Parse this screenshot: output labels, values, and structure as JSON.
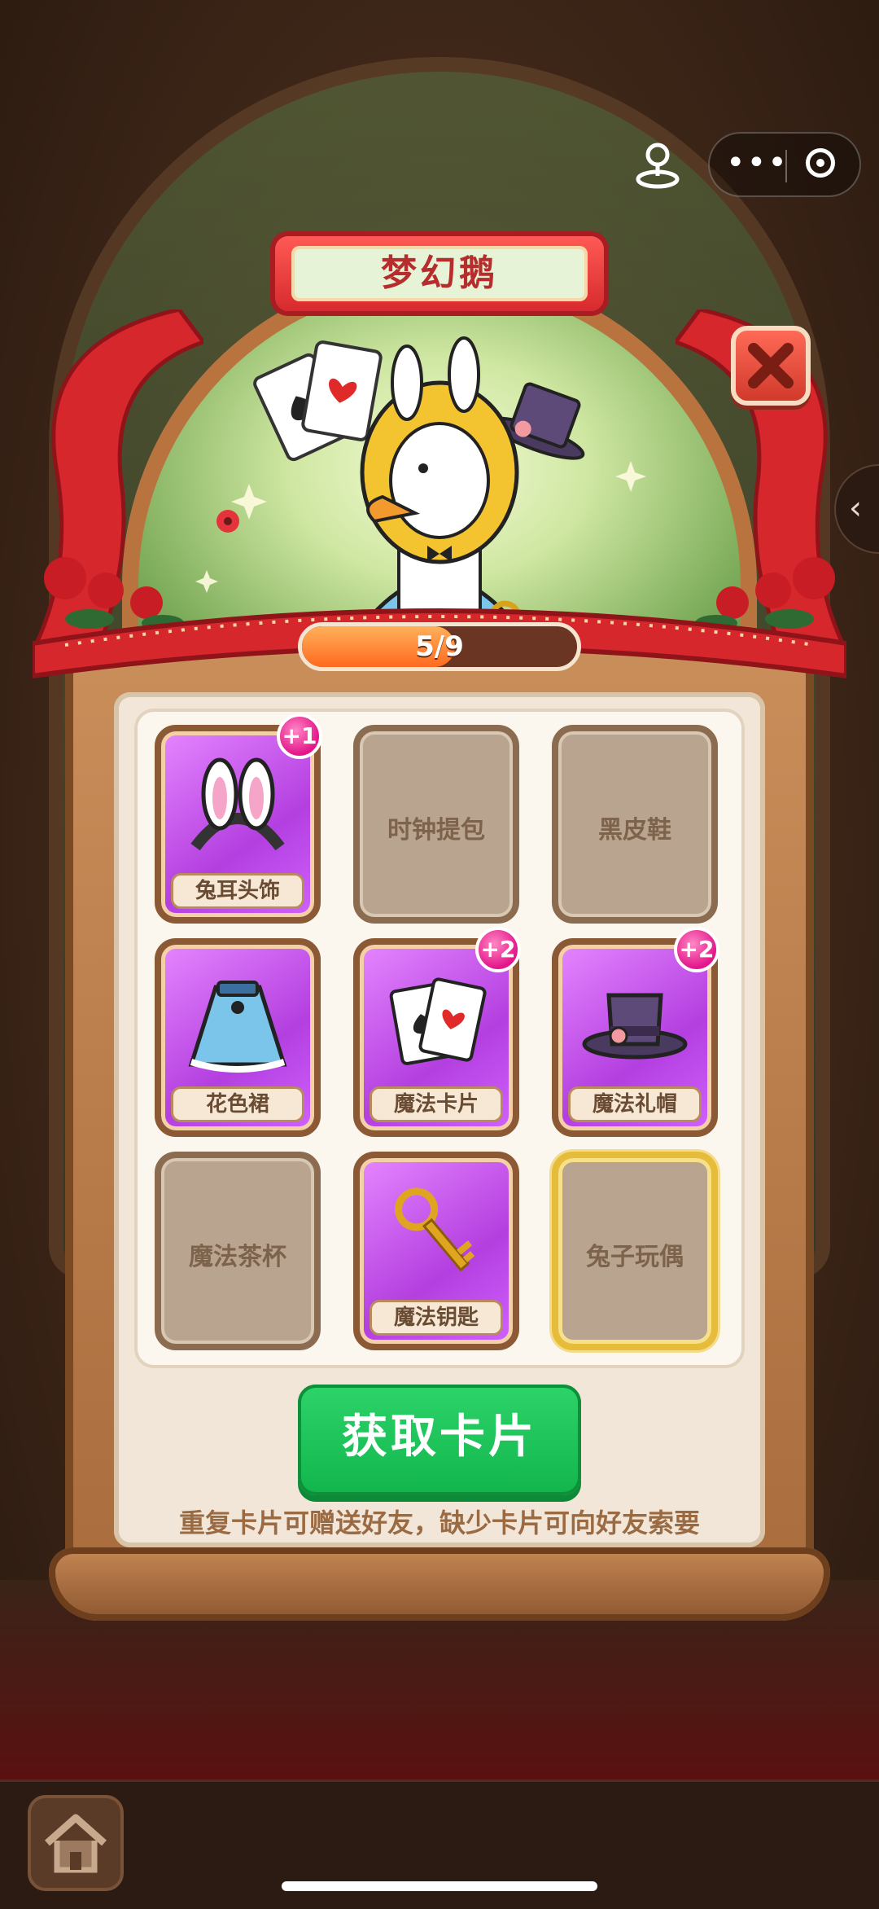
{
  "header": {
    "title": "梦幻鹅",
    "progress_text": "5/9",
    "progress_fraction": 0.556
  },
  "cards": [
    {
      "name": "兔耳头饰",
      "owned": true,
      "badge": "+1",
      "icon": "bunny-ears-headband-icon"
    },
    {
      "name": "时钟提包",
      "owned": false,
      "badge": "",
      "icon": ""
    },
    {
      "name": "黑皮鞋",
      "owned": false,
      "badge": "",
      "icon": ""
    },
    {
      "name": "花色裙",
      "owned": true,
      "badge": "",
      "icon": "floral-skirt-icon"
    },
    {
      "name": "魔法卡片",
      "owned": true,
      "badge": "+2",
      "icon": "playing-cards-icon"
    },
    {
      "name": "魔法礼帽",
      "owned": true,
      "badge": "+2",
      "icon": "top-hat-icon"
    },
    {
      "name": "魔法茶杯",
      "owned": false,
      "badge": "",
      "icon": ""
    },
    {
      "name": "魔法钥匙",
      "owned": true,
      "badge": "",
      "icon": "golden-key-icon"
    },
    {
      "name": "兔子玩偶",
      "owned": false,
      "badge": "",
      "icon": "",
      "highlighted": true
    }
  ],
  "actions": {
    "get_cards_label": "获取卡片",
    "hint": "重复卡片可赠送好友，缺少卡片可向好友索要"
  },
  "colors": {
    "accent_green": "#1ec45a",
    "card_purple": "#c04fe8",
    "badge_pink": "#e3168a",
    "banner_red": "#d72a2e"
  }
}
